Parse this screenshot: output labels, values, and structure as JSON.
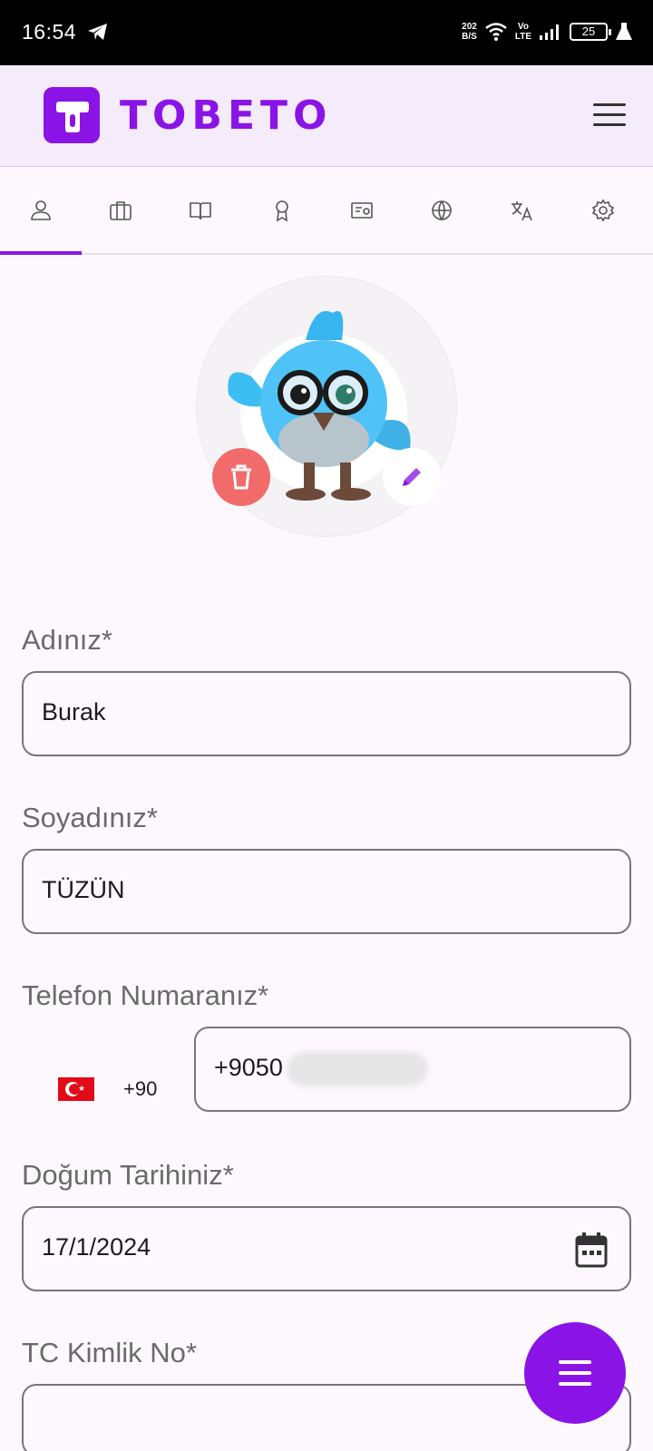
{
  "status_bar": {
    "time": "16:54",
    "speed_value": "202",
    "speed_unit": "B/S",
    "volte_top": "Vo",
    "volte_bottom": "LTE",
    "battery": "25"
  },
  "app_bar": {
    "brand": "TOBETO",
    "brand_color": "#8a14e6"
  },
  "tabs": [
    {
      "icon": "person-icon",
      "active": true
    },
    {
      "icon": "briefcase-icon"
    },
    {
      "icon": "book-icon"
    },
    {
      "icon": "award-icon"
    },
    {
      "icon": "certificate-icon"
    },
    {
      "icon": "globe-icon"
    },
    {
      "icon": "translate-icon"
    },
    {
      "icon": "gear-icon"
    }
  ],
  "form": {
    "first_name_label": "Adınız*",
    "first_name_value": "Burak",
    "last_name_label": "Soyadınız*",
    "last_name_value": "TÜZÜN",
    "phone_label": "Telefon Numaranız*",
    "phone_country_code": "+90",
    "phone_value": "+9050",
    "birth_label": "Doğum Tarihiniz*",
    "birth_value": "17/1/2024",
    "tc_label": "TC Kimlik No*"
  },
  "colors": {
    "accent": "#8a14e6",
    "delete": "#f26b6b",
    "background": "#fdf8fd"
  }
}
